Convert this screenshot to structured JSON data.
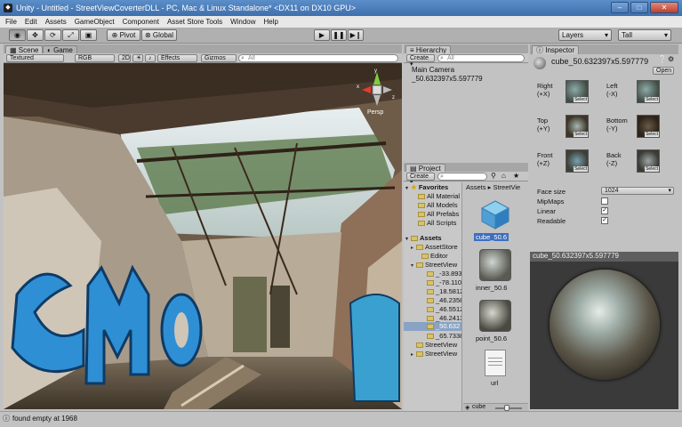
{
  "window": {
    "title": "Unity - Untitled - StreetViewCoverterDLL - PC, Mac & Linux Standalone* <DX11 on DX10 GPU>",
    "minimize": "–",
    "maximize": "□",
    "close": "✕"
  },
  "menu": [
    "File",
    "Edit",
    "Assets",
    "GameObject",
    "Component",
    "Asset Store Tools",
    "Window",
    "Help"
  ],
  "toolbar": {
    "pivot": "Pivot",
    "global": "Global",
    "layers": "Layers",
    "layout": "Tall"
  },
  "scene": {
    "tab_scene": "Scene",
    "tab_game": "Game",
    "render_mode": "Textured",
    "color_mode": "RGB",
    "mode_2d": "2D",
    "effects": "Effects",
    "gizmos": "Gizmos",
    "search_placeholder": "All",
    "persp": "Persp",
    "gizmo_y": "y",
    "gizmo_x": "x",
    "gizmo_z": "z"
  },
  "hierarchy": {
    "tab": "Hierarchy",
    "create": "Create",
    "search_placeholder": "All",
    "items": [
      "Main Camera",
      "_50.632397x5.597779"
    ]
  },
  "project": {
    "tab": "Project",
    "create": "Create",
    "favorites_label": "Favorites",
    "favorites": [
      "All Material",
      "All Models",
      "All Prefabs",
      "All Scripts"
    ],
    "assets_label": "Assets",
    "tree": [
      "AssetStore",
      "Editor",
      "StreetView",
      "_-33.893",
      "_-78.110",
      "_18.5812",
      "_46.2358",
      "_46.5512",
      "_46.2413",
      "_50.632",
      "_65.7338",
      "StreetView",
      "StreetView"
    ],
    "breadcrumb_root": "Assets",
    "breadcrumb_child": "StreetVie",
    "grid": [
      "cube_50.6",
      "inner_50.6",
      "point_50.6",
      "url"
    ],
    "footer_label": "cube"
  },
  "inspector": {
    "tab": "Inspector",
    "object_name": "cube_50.632397x5.597779",
    "open": "Open",
    "faces": [
      {
        "name": "Right",
        "axis": "(+X)"
      },
      {
        "name": "Left",
        "axis": "(-X)"
      },
      {
        "name": "Top",
        "axis": "(+Y)"
      },
      {
        "name": "Bottom",
        "axis": "(-Y)"
      },
      {
        "name": "Front",
        "axis": "(+Z)"
      },
      {
        "name": "Back",
        "axis": "(-Z)"
      }
    ],
    "select": "Select",
    "face_size_label": "Face size",
    "face_size_value": "1024",
    "mipmaps_label": "MipMaps",
    "linear_label": "Linear",
    "readable_label": "Readable",
    "mipmaps": false,
    "linear": true,
    "readable": true
  },
  "preview": {
    "title": "cube_50.632397x5.597779"
  },
  "status": {
    "message": "found empty at 1968"
  }
}
